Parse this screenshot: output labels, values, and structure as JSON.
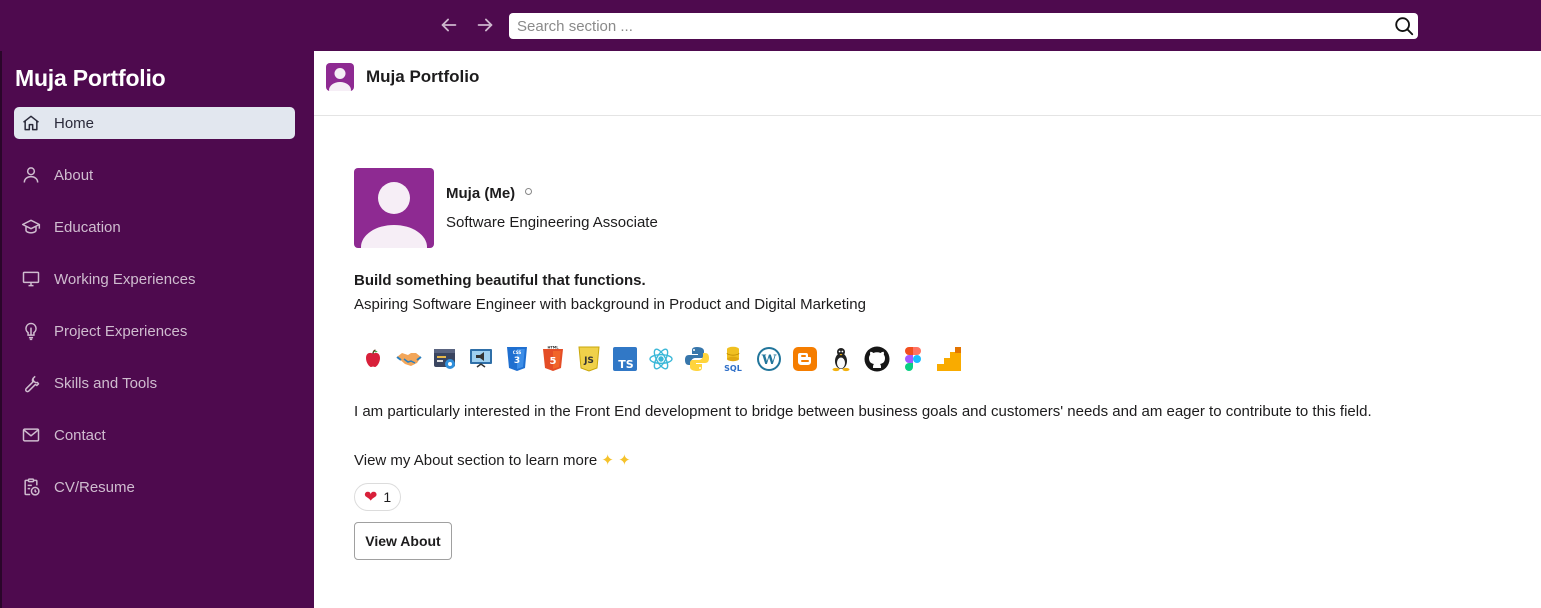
{
  "topbar": {
    "back_icon": "arrow-left-icon",
    "forward_icon": "arrow-right-icon",
    "search_placeholder": "Search section ...",
    "search_value": ""
  },
  "sidebar": {
    "brand": "Muja Portfolio",
    "items": [
      {
        "label": "Home",
        "icon": "home-icon",
        "active": true
      },
      {
        "label": "About",
        "icon": "user-icon",
        "active": false
      },
      {
        "label": "Education",
        "icon": "graduation-cap-icon",
        "active": false
      },
      {
        "label": "Working Experiences",
        "icon": "monitor-icon",
        "active": false
      },
      {
        "label": "Project Experiences",
        "icon": "lightbulb-icon",
        "active": false
      },
      {
        "label": "Skills and Tools",
        "icon": "wrench-icon",
        "active": false
      },
      {
        "label": "Contact",
        "icon": "mail-icon",
        "active": false
      },
      {
        "label": "CV/Resume",
        "icon": "clipboard-clock-icon",
        "active": false
      }
    ]
  },
  "header": {
    "title": "Muja Portfolio"
  },
  "profile": {
    "name": "Muja (Me)",
    "role": "Software Engineering Associate",
    "headline": "Build something beautiful that functions.",
    "subheadline": "Aspiring Software Engineer with background in Product and Digital Marketing",
    "tech_icons": [
      "apple-icon",
      "handshake-icon",
      "web-settings-icon",
      "presentation-icon",
      "css3-icon",
      "html5-icon",
      "javascript-icon",
      "typescript-icon",
      "react-icon",
      "python-icon",
      "sql-icon",
      "wordpress-icon",
      "blogger-icon",
      "linux-icon",
      "github-icon",
      "figma-icon",
      "google-analytics-icon"
    ],
    "paragraph": "I am particularly interested in the Front End development to bridge between business goals and customers' needs and am eager to contribute to this field.",
    "cta_text": "View my About section to learn more",
    "reaction_count": "1",
    "view_button": "View About"
  },
  "colors": {
    "brand_purple": "#4e0a4e",
    "avatar_purple": "#8e2a92",
    "active_item_bg": "#e2e7ef"
  }
}
